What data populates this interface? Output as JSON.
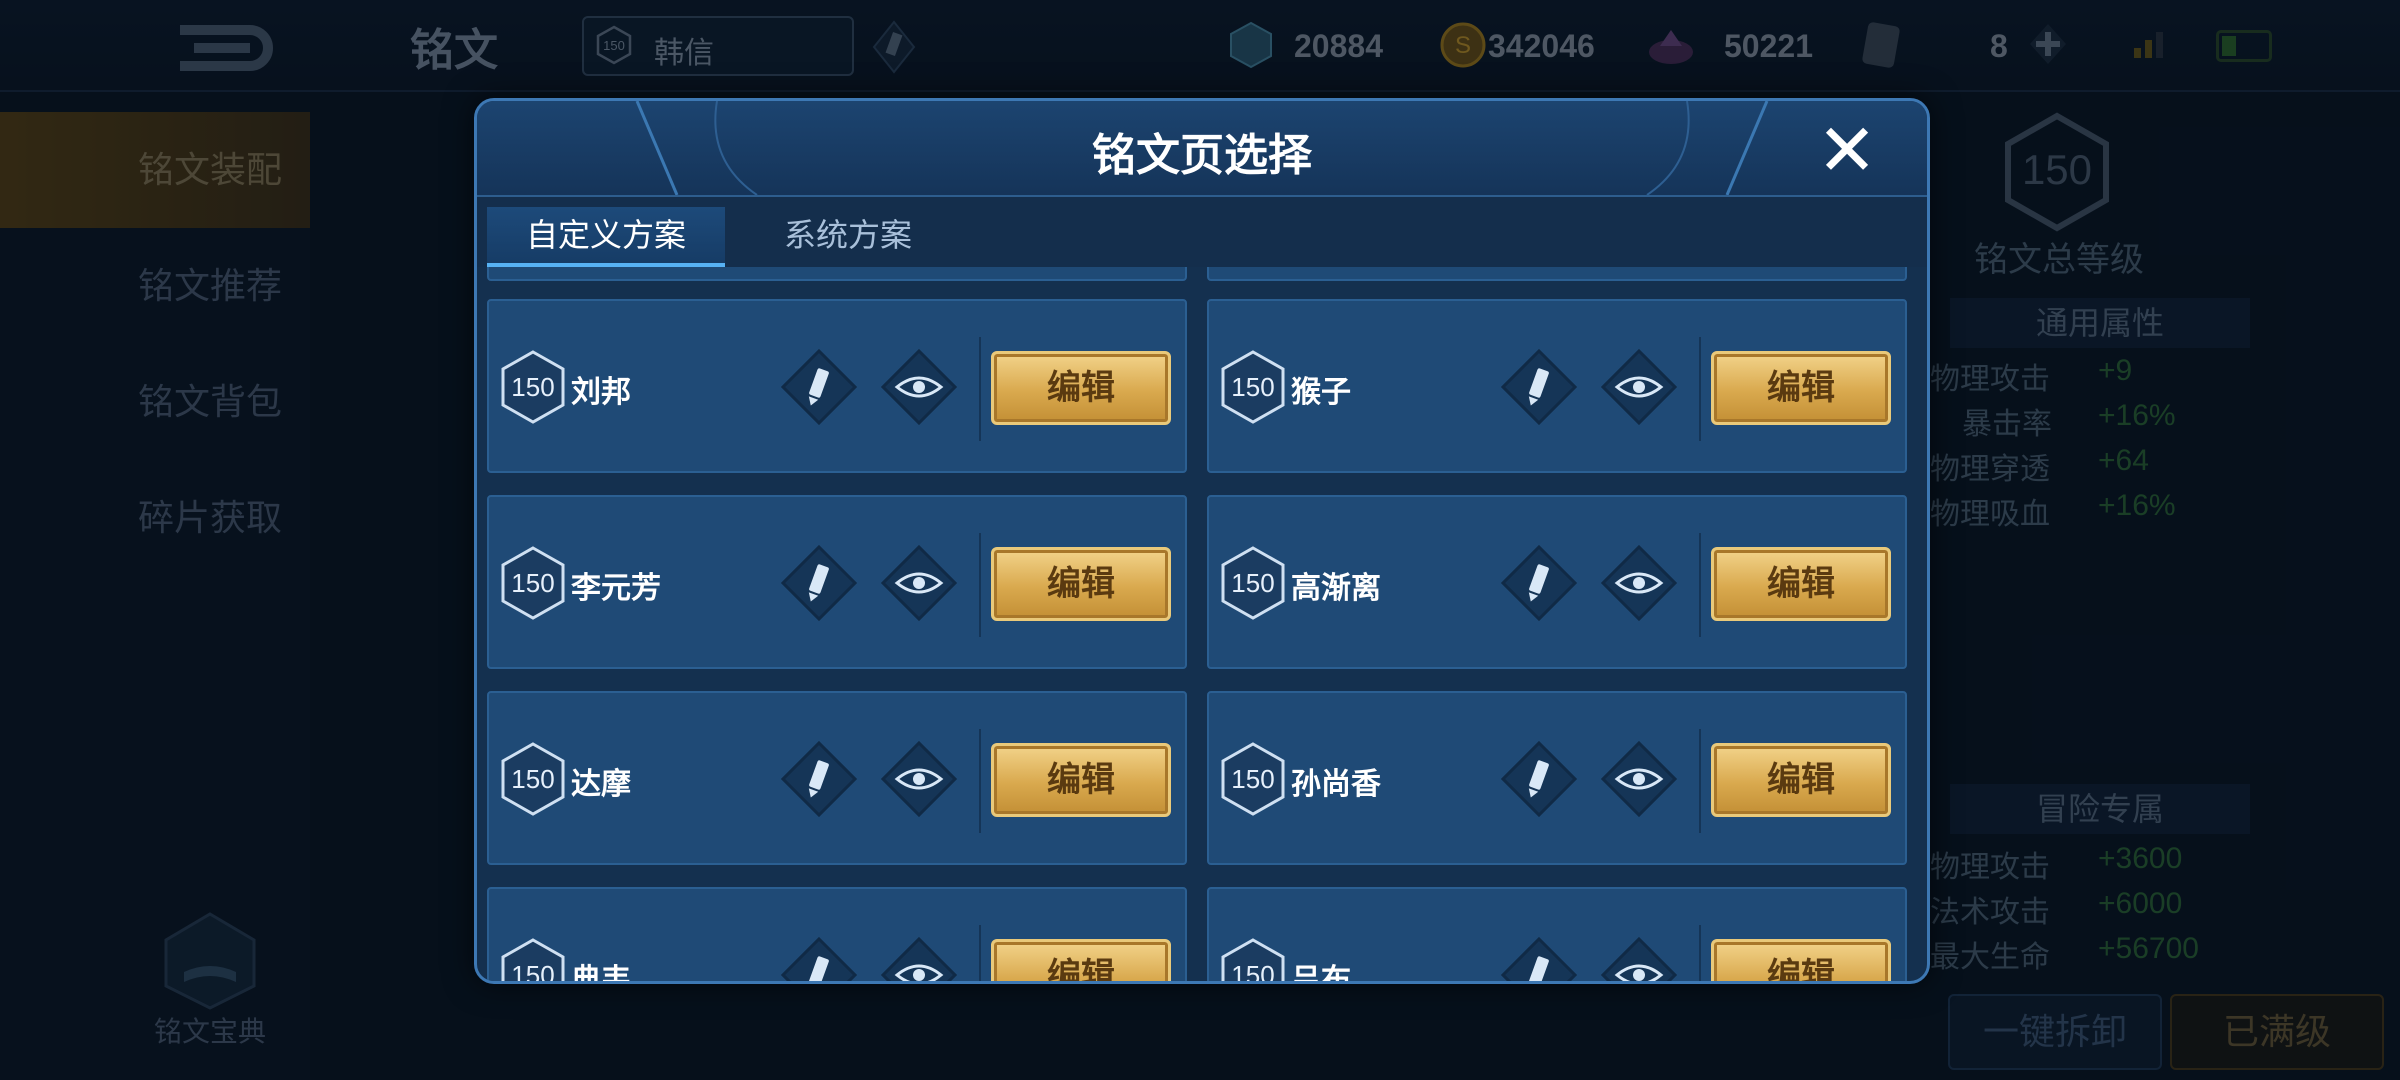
{
  "topbar": {
    "page_title": "铭文",
    "hero_level": "150",
    "hero_name": "韩信",
    "currencies": [
      {
        "icon": "diamond-coupon-icon",
        "value": "20884"
      },
      {
        "icon": "gold-coin-icon",
        "value": "342046"
      },
      {
        "icon": "gem-pile-icon",
        "value": "50221"
      },
      {
        "icon": "card-icon",
        "value": "8"
      }
    ]
  },
  "leftnav": {
    "items": [
      {
        "label": "铭文装配",
        "active": true
      },
      {
        "label": "铭文推荐"
      },
      {
        "label": "铭文背包"
      },
      {
        "label": "碎片获取"
      }
    ],
    "codex_label": "铭文宝典"
  },
  "rightpanel": {
    "total_level": "150",
    "total_label": "铭文总等级",
    "general_header": "通用属性",
    "general_stats": [
      {
        "k": "物理攻击",
        "v": "+9"
      },
      {
        "k": "暴击率",
        "v": "+16%"
      },
      {
        "k": "物理穿透",
        "v": "+64"
      },
      {
        "k": "物理吸血",
        "v": "+16%"
      }
    ],
    "adventure_header": "冒险专属",
    "adventure_stats": [
      {
        "k": "物理攻击",
        "v": "+3600"
      },
      {
        "k": "法术攻击",
        "v": "+6000"
      },
      {
        "k": "最大生命",
        "v": "+56700"
      }
    ],
    "btn_unload": "一键拆卸",
    "btn_maxed": "已满级"
  },
  "modal": {
    "title": "铭文页选择",
    "tabs": [
      "自定义方案",
      "系统方案"
    ],
    "edit_label": "编辑",
    "pages": [
      {
        "level": "150",
        "name": "刘邦"
      },
      {
        "level": "150",
        "name": "猴子"
      },
      {
        "level": "150",
        "name": "李元芳"
      },
      {
        "level": "150",
        "name": "高渐离"
      },
      {
        "level": "150",
        "name": "达摩"
      },
      {
        "level": "150",
        "name": "孙尚香"
      },
      {
        "level": "150",
        "name": "典韦"
      },
      {
        "level": "150",
        "name": "吕布"
      }
    ]
  },
  "colors": {
    "accent_blue": "#57b2f4",
    "edit_gold": "#d9a94e",
    "modal_bg": "#14304f"
  }
}
